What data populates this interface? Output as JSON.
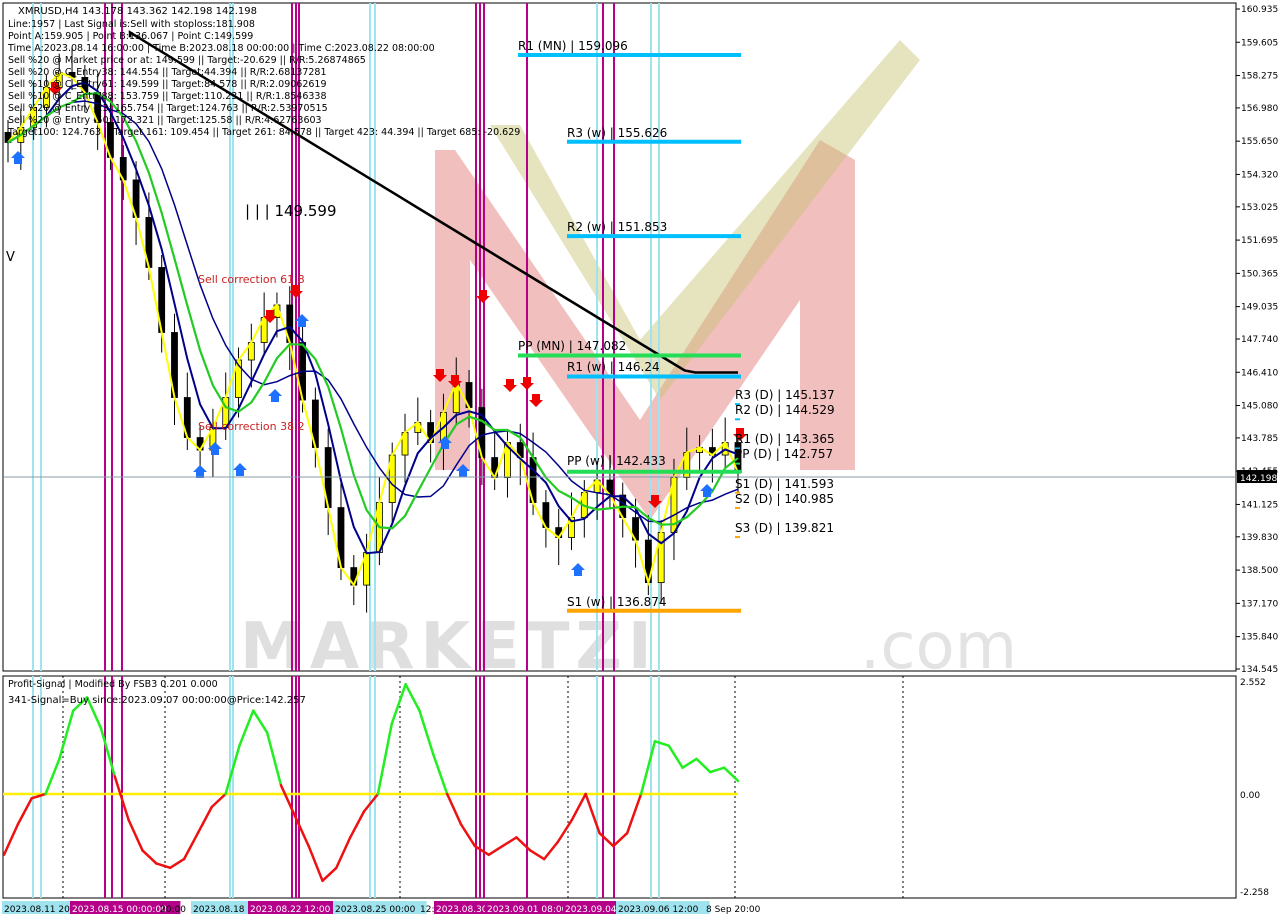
{
  "header": {
    "symbol_line": "XMRUSD,H4  143.178 143.362 142.198 142.198",
    "lines": [
      "Line:1957 | Last Signal is:Sell with stoploss:181.908",
      "Point A:159.905 | Point B:136.067 | Point C:149.599",
      "Time A:2023.08.14 16:00:00 | Time B:2023.08.18 00:00:00 | Time C:2023.08.22 08:00:00",
      "Sell %20 @ Market price or at: 149.599 || Target:-20.629 || R/R:5.26874865",
      "Sell %20 @ C_Entry38: 144.554 || Target:44.394 || R/R:2.68137281",
      "Sell %10 @ C_Entry61: 149.599 || Target:84.578 || R/R:2.09062619",
      "Sell %10 @ C_Entry88: 153.759 || Target:110.231 || R/R:1.8546338",
      "Sell %20 @ Entry -23: 165.754 || Target:124.763 || R/R:2.53970515",
      "Sell %20 @ Entry -50: 172.321 || Target:125.58 || R/R:4.62763603",
      "Target100: 124.763 || Target 161: 109.454 || Target 261: 84.578 || Target 423: 44.394 || Target 685: -20.629"
    ]
  },
  "annotations": {
    "point_c": "| | | 149.599",
    "v_mark": "V",
    "sell_corr_618": "Sell correction 61.8",
    "sell_corr_382": "Sell correction 38.2"
  },
  "levels": {
    "r1_mn": "R1 (MN) | 159.096",
    "r3_w": "R3 (w) | 155.626",
    "r2_w": "R2 (w) | 151.853",
    "pp_mn": "PP (MN) | 147.082",
    "r1_w": "R1 (w) | 146.24",
    "pp_w": "PP (w) | 142.433",
    "s1_w": "S1 (w) | 136.874",
    "r3_d": "R3 (D) | 145.137",
    "r2_d": "R2 (D) | 144.529",
    "r1_d": "R1 (D) | 143.365",
    "pp_d": "PP (D) | 142.757",
    "s1_d": "S1 (D) | 141.593",
    "s2_d": "S2 (D) | 140.985",
    "s3_d": "S3 (D) | 139.821"
  },
  "price_axis": {
    "ticks": [
      "160.935",
      "159.605",
      "158.275",
      "156.980",
      "155.650",
      "154.320",
      "153.025",
      "151.695",
      "150.365",
      "149.035",
      "147.740",
      "146.410",
      "145.080",
      "143.785",
      "142.455",
      "141.125",
      "139.830",
      "138.500",
      "137.170",
      "135.840",
      "134.545"
    ],
    "current_price": "142.198"
  },
  "oscillator": {
    "title": "Profit-Signal | Modified By FSB3 0.201 0.000",
    "signal": "341-Signal=Buy since:2023.09.07 00:00:00@Price:142.257",
    "ticks": [
      "2.552",
      "0.00",
      "-2.258"
    ]
  },
  "time_axis": {
    "labels": [
      "2023.08.11 20:00",
      "2023.08.15 00:00:00",
      "20:00",
      "2023.08.18 20:00",
      "2023.08.22 12:00",
      "2023.08.25 00:00",
      "12:00",
      "2023.08.30",
      "2023.09.01 08:00",
      "2023.09.04",
      "2023.09.06 12:00",
      "8 Sep 20:00"
    ]
  },
  "colors": {
    "bull_candle": "#ffff00",
    "bear_candle": "#000000",
    "ma_fast": "#00008b",
    "ma_mid": "#22cc22",
    "ma_slow": "#000000",
    "resistance": "#00bfff",
    "pivot_monthly": "#22dd55",
    "support": "#ffa500",
    "signal_sell": "#ee0000",
    "signal_buy": "#1e70ff",
    "vline_magenta": "#b5008a",
    "vline_cyan": "#9fe3ee"
  },
  "chart_data": {
    "type": "line",
    "symbol": "XMRUSD",
    "timeframe": "H4",
    "ylim": [
      134.545,
      160.935
    ],
    "last_price": 142.198,
    "ohlc_header": {
      "open": 143.178,
      "high": 143.362,
      "low": 142.198,
      "close": 142.198
    },
    "close_series_approx": [
      155.6,
      156.2,
      157.0,
      157.8,
      158.4,
      158.2,
      157.6,
      156.4,
      155.0,
      154.1,
      152.6,
      150.6,
      148.0,
      145.4,
      143.8,
      143.3,
      144.2,
      145.4,
      146.9,
      147.6,
      148.6,
      149.1,
      147.6,
      145.3,
      143.4,
      141.0,
      138.6,
      137.9,
      139.2,
      141.2,
      143.1,
      144.0,
      144.4,
      143.6,
      144.8,
      146.0,
      145.0,
      143.0,
      142.2,
      143.6,
      143.0,
      141.2,
      140.2,
      139.8,
      140.6,
      141.6,
      142.1,
      141.5,
      140.6,
      139.7,
      138.0,
      140.0,
      142.2,
      143.2,
      143.4,
      143.1,
      143.6,
      142.4
    ],
    "pivot_levels": [
      {
        "name": "R1 (MN)",
        "value": 159.096
      },
      {
        "name": "R3 (w)",
        "value": 155.626
      },
      {
        "name": "R2 (w)",
        "value": 151.853
      },
      {
        "name": "PP (MN)",
        "value": 147.082
      },
      {
        "name": "R1 (w)",
        "value": 146.24
      },
      {
        "name": "PP (w)",
        "value": 142.433
      },
      {
        "name": "S1 (w)",
        "value": 136.874
      },
      {
        "name": "R3 (D)",
        "value": 145.137
      },
      {
        "name": "R2 (D)",
        "value": 144.529
      },
      {
        "name": "R1 (D)",
        "value": 143.365
      },
      {
        "name": "PP (D)",
        "value": 142.757
      },
      {
        "name": "S1 (D)",
        "value": 141.593
      },
      {
        "name": "S2 (D)",
        "value": 140.985
      },
      {
        "name": "S3 (D)",
        "value": 139.821
      }
    ],
    "oscillator_series_approx": [
      -1.4,
      -0.7,
      -0.1,
      0.0,
      0.8,
      1.9,
      2.2,
      1.5,
      0.4,
      -0.6,
      -1.3,
      -1.6,
      -1.7,
      -1.5,
      -0.9,
      -0.3,
      0.0,
      1.1,
      1.9,
      1.4,
      0.2,
      -0.5,
      -1.2,
      -2.0,
      -1.7,
      -1.0,
      -0.4,
      0.0,
      1.6,
      2.5,
      1.9,
      0.9,
      0.0,
      -0.7,
      -1.2,
      -1.4,
      -1.2,
      -1.0,
      -1.3,
      -1.5,
      -1.1,
      -0.6,
      0.0,
      -0.9,
      -1.2,
      -0.9,
      0.0,
      1.2,
      1.1,
      0.6,
      0.8,
      0.5,
      0.6,
      0.3
    ]
  }
}
